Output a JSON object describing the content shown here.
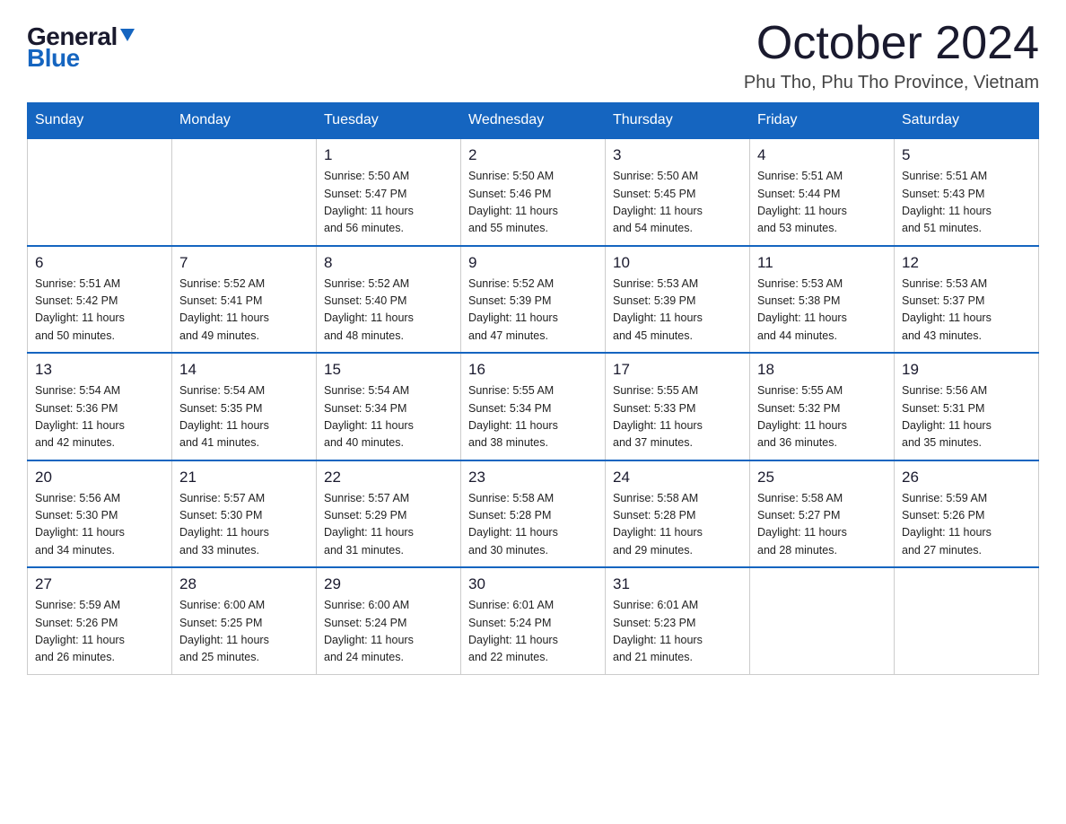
{
  "logo": {
    "general": "General",
    "blue": "Blue"
  },
  "title": "October 2024",
  "location": "Phu Tho, Phu Tho Province, Vietnam",
  "days_of_week": [
    "Sunday",
    "Monday",
    "Tuesday",
    "Wednesday",
    "Thursday",
    "Friday",
    "Saturday"
  ],
  "weeks": [
    [
      {
        "day": "",
        "info": ""
      },
      {
        "day": "",
        "info": ""
      },
      {
        "day": "1",
        "info": "Sunrise: 5:50 AM\nSunset: 5:47 PM\nDaylight: 11 hours\nand 56 minutes."
      },
      {
        "day": "2",
        "info": "Sunrise: 5:50 AM\nSunset: 5:46 PM\nDaylight: 11 hours\nand 55 minutes."
      },
      {
        "day": "3",
        "info": "Sunrise: 5:50 AM\nSunset: 5:45 PM\nDaylight: 11 hours\nand 54 minutes."
      },
      {
        "day": "4",
        "info": "Sunrise: 5:51 AM\nSunset: 5:44 PM\nDaylight: 11 hours\nand 53 minutes."
      },
      {
        "day": "5",
        "info": "Sunrise: 5:51 AM\nSunset: 5:43 PM\nDaylight: 11 hours\nand 51 minutes."
      }
    ],
    [
      {
        "day": "6",
        "info": "Sunrise: 5:51 AM\nSunset: 5:42 PM\nDaylight: 11 hours\nand 50 minutes."
      },
      {
        "day": "7",
        "info": "Sunrise: 5:52 AM\nSunset: 5:41 PM\nDaylight: 11 hours\nand 49 minutes."
      },
      {
        "day": "8",
        "info": "Sunrise: 5:52 AM\nSunset: 5:40 PM\nDaylight: 11 hours\nand 48 minutes."
      },
      {
        "day": "9",
        "info": "Sunrise: 5:52 AM\nSunset: 5:39 PM\nDaylight: 11 hours\nand 47 minutes."
      },
      {
        "day": "10",
        "info": "Sunrise: 5:53 AM\nSunset: 5:39 PM\nDaylight: 11 hours\nand 45 minutes."
      },
      {
        "day": "11",
        "info": "Sunrise: 5:53 AM\nSunset: 5:38 PM\nDaylight: 11 hours\nand 44 minutes."
      },
      {
        "day": "12",
        "info": "Sunrise: 5:53 AM\nSunset: 5:37 PM\nDaylight: 11 hours\nand 43 minutes."
      }
    ],
    [
      {
        "day": "13",
        "info": "Sunrise: 5:54 AM\nSunset: 5:36 PM\nDaylight: 11 hours\nand 42 minutes."
      },
      {
        "day": "14",
        "info": "Sunrise: 5:54 AM\nSunset: 5:35 PM\nDaylight: 11 hours\nand 41 minutes."
      },
      {
        "day": "15",
        "info": "Sunrise: 5:54 AM\nSunset: 5:34 PM\nDaylight: 11 hours\nand 40 minutes."
      },
      {
        "day": "16",
        "info": "Sunrise: 5:55 AM\nSunset: 5:34 PM\nDaylight: 11 hours\nand 38 minutes."
      },
      {
        "day": "17",
        "info": "Sunrise: 5:55 AM\nSunset: 5:33 PM\nDaylight: 11 hours\nand 37 minutes."
      },
      {
        "day": "18",
        "info": "Sunrise: 5:55 AM\nSunset: 5:32 PM\nDaylight: 11 hours\nand 36 minutes."
      },
      {
        "day": "19",
        "info": "Sunrise: 5:56 AM\nSunset: 5:31 PM\nDaylight: 11 hours\nand 35 minutes."
      }
    ],
    [
      {
        "day": "20",
        "info": "Sunrise: 5:56 AM\nSunset: 5:30 PM\nDaylight: 11 hours\nand 34 minutes."
      },
      {
        "day": "21",
        "info": "Sunrise: 5:57 AM\nSunset: 5:30 PM\nDaylight: 11 hours\nand 33 minutes."
      },
      {
        "day": "22",
        "info": "Sunrise: 5:57 AM\nSunset: 5:29 PM\nDaylight: 11 hours\nand 31 minutes."
      },
      {
        "day": "23",
        "info": "Sunrise: 5:58 AM\nSunset: 5:28 PM\nDaylight: 11 hours\nand 30 minutes."
      },
      {
        "day": "24",
        "info": "Sunrise: 5:58 AM\nSunset: 5:28 PM\nDaylight: 11 hours\nand 29 minutes."
      },
      {
        "day": "25",
        "info": "Sunrise: 5:58 AM\nSunset: 5:27 PM\nDaylight: 11 hours\nand 28 minutes."
      },
      {
        "day": "26",
        "info": "Sunrise: 5:59 AM\nSunset: 5:26 PM\nDaylight: 11 hours\nand 27 minutes."
      }
    ],
    [
      {
        "day": "27",
        "info": "Sunrise: 5:59 AM\nSunset: 5:26 PM\nDaylight: 11 hours\nand 26 minutes."
      },
      {
        "day": "28",
        "info": "Sunrise: 6:00 AM\nSunset: 5:25 PM\nDaylight: 11 hours\nand 25 minutes."
      },
      {
        "day": "29",
        "info": "Sunrise: 6:00 AM\nSunset: 5:24 PM\nDaylight: 11 hours\nand 24 minutes."
      },
      {
        "day": "30",
        "info": "Sunrise: 6:01 AM\nSunset: 5:24 PM\nDaylight: 11 hours\nand 22 minutes."
      },
      {
        "day": "31",
        "info": "Sunrise: 6:01 AM\nSunset: 5:23 PM\nDaylight: 11 hours\nand 21 minutes."
      },
      {
        "day": "",
        "info": ""
      },
      {
        "day": "",
        "info": ""
      }
    ]
  ]
}
